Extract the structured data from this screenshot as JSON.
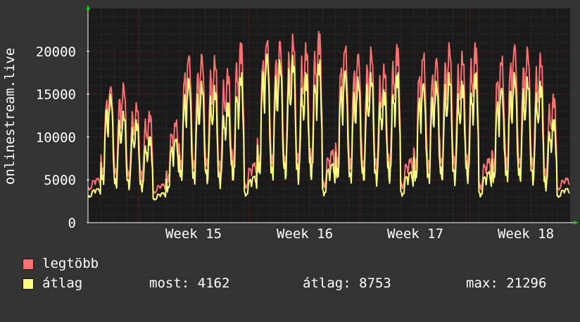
{
  "chart_data": {
    "type": "line",
    "ylabel": "onlinestream.live",
    "ylim": [
      0,
      25000
    ],
    "y_ticks": [
      0,
      5000,
      10000,
      15000,
      20000
    ],
    "x_tick_labels": [
      "Week 15",
      "Week 16",
      "Week 17",
      "Week 18"
    ],
    "grid": true,
    "series": [
      {
        "name": "legtöbb",
        "color": "#ff7070",
        "daily_peaks": [
          5200,
          16200,
          16300,
          14000,
          13000,
          4500,
          12000,
          20000,
          19800,
          19500,
          18000,
          21000,
          7000,
          21800,
          21500,
          22000,
          21000,
          22300,
          8500,
          21000,
          20000,
          20500,
          18500,
          20800,
          7500,
          20000,
          19500,
          21000,
          20000,
          21000,
          7500,
          19500,
          21200,
          20500,
          19800,
          15000,
          5200
        ],
        "daily_troughs": [
          3600,
          3400,
          3200,
          3400,
          3600,
          3300,
          3400,
          3500,
          3300,
          3600,
          3400,
          3400,
          3500,
          3800,
          3600,
          3400,
          3500,
          3400,
          3300,
          3600,
          3500,
          3400,
          3600,
          3300,
          3400,
          3500,
          3400,
          3600,
          3500,
          3400,
          3300,
          3500,
          3400,
          3600,
          3400,
          3300,
          3600
        ]
      },
      {
        "name": "átlag",
        "color": "#ffff80",
        "daily_peaks": [
          4000,
          15000,
          13000,
          12000,
          10000,
          3500,
          10000,
          17000,
          16500,
          16000,
          14000,
          17500,
          5500,
          20000,
          19000,
          19500,
          17500,
          19000,
          7000,
          18000,
          17000,
          17500,
          15500,
          17500,
          6000,
          16500,
          16500,
          17500,
          16500,
          17500,
          6000,
          16000,
          17500,
          17000,
          16500,
          12000,
          4000
        ],
        "daily_troughs": [
          2800,
          2600,
          2500,
          2600,
          2700,
          2500,
          2500,
          2700,
          2500,
          2700,
          2600,
          2600,
          2700,
          2900,
          2700,
          2600,
          2700,
          2600,
          2500,
          2700,
          2600,
          2600,
          2700,
          2500,
          2600,
          2700,
          2600,
          2700,
          2600,
          2600,
          2500,
          2700,
          2600,
          2700,
          2600,
          2500,
          2800
        ]
      }
    ]
  },
  "legend": {
    "items": [
      {
        "label": "legtöbb",
        "color": "#ff7070"
      },
      {
        "label": "átlag",
        "color": "#ffff80"
      }
    ]
  },
  "stats": {
    "most": "most: 4162",
    "atlag": "átlag: 8753",
    "max": "max: 21296"
  },
  "colors": {
    "background": "#333333",
    "plot_background": "#1a1a1a",
    "grid_major": "#7a2a2a",
    "axis": "#ffffff",
    "arrow": "#00cc00"
  }
}
